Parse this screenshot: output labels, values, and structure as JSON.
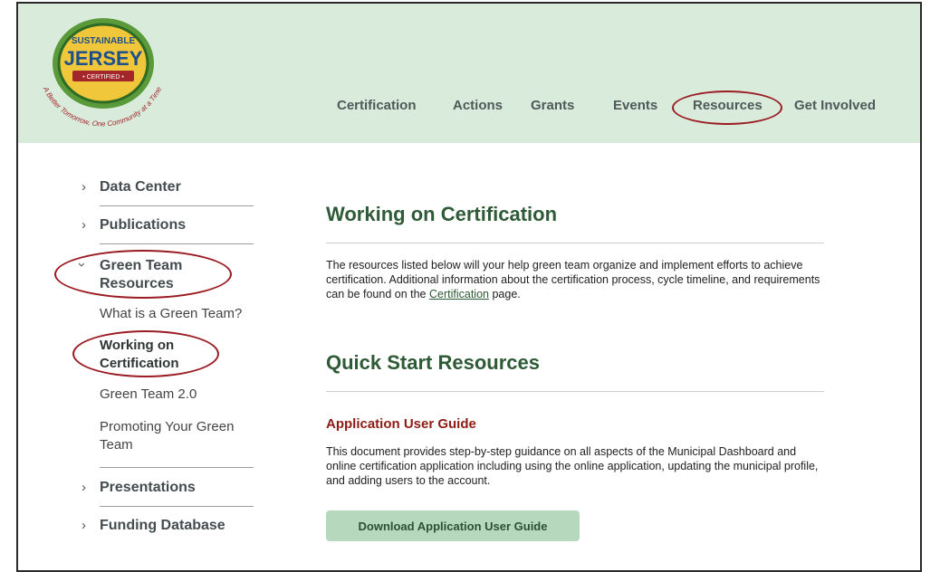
{
  "header": {
    "logo": {
      "line1": "SUSTAINABLE",
      "line2": "JERSEY",
      "line3": "• CERTIFIED •",
      "tagline": "A Better Tomorrow, One Community at a Time"
    },
    "nav": [
      "Certification",
      "Actions",
      "Grants",
      "Events",
      "Resources",
      "Get Involved"
    ],
    "highlighted_nav": "Resources"
  },
  "sidebar": {
    "items": [
      "Data Center",
      "Publications",
      "Green Team Resources",
      "Presentations",
      "Funding Database"
    ],
    "expanded_item": "Green Team Resources",
    "sub_items": [
      "What is a Green Team?",
      "Working on Certification",
      "Green Team 2.0",
      "Promoting Your Green Team"
    ],
    "active_sub_item": "Working on Certification"
  },
  "main": {
    "title": "Working on Certification",
    "intro_before_link": "The resources listed below will your help green team organize and implement efforts to achieve certification. Additional information about the certification process, cycle timeline, and requirements can be found on the ",
    "intro_link": "Certification",
    "intro_after_link": " page.",
    "quick_start_title": "Quick Start Resources",
    "guide_title": "Application User Guide",
    "guide_text": "This document provides step-by-step guidance on all aspects of the Municipal Dashboard and online certification application including using the online application, updating the municipal profile, and adding users to the account.",
    "guide_button": "Download Application User Guide"
  },
  "colors": {
    "header_bg": "#d9ebdb",
    "heading_green": "#2e5a36",
    "accent_red": "#9b1b22",
    "button_bg": "#b6d9bd"
  }
}
